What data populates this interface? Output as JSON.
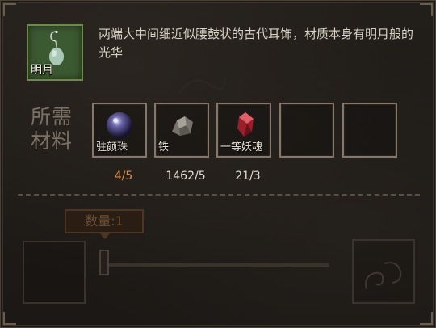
{
  "item": {
    "name": "明月",
    "icon": "jade-earring-icon",
    "description": "两端大中间细近似腰鼓状的古代耳饰，材质本身有明月般的光华"
  },
  "requirements": {
    "label": "所需材料",
    "materials": [
      {
        "name": "驻颜珠",
        "icon": "purple-orb-icon",
        "count": "4/5",
        "sufficient": false
      },
      {
        "name": "铁",
        "icon": "iron-ore-icon",
        "count": "1462/5",
        "sufficient": true
      },
      {
        "name": "一等妖魂",
        "icon": "red-crystal-icon",
        "count": "21/3",
        "sufficient": true
      },
      {
        "name": "",
        "icon": "",
        "count": "",
        "sufficient": true
      },
      {
        "name": "",
        "icon": "",
        "count": "",
        "sufficient": true
      }
    ]
  },
  "quantity": {
    "label": "数量:1",
    "value": 1
  },
  "colors": {
    "insufficient": "#e08a3a",
    "item_bg": "#3c5a32",
    "panel_bg": "#1a1714"
  }
}
